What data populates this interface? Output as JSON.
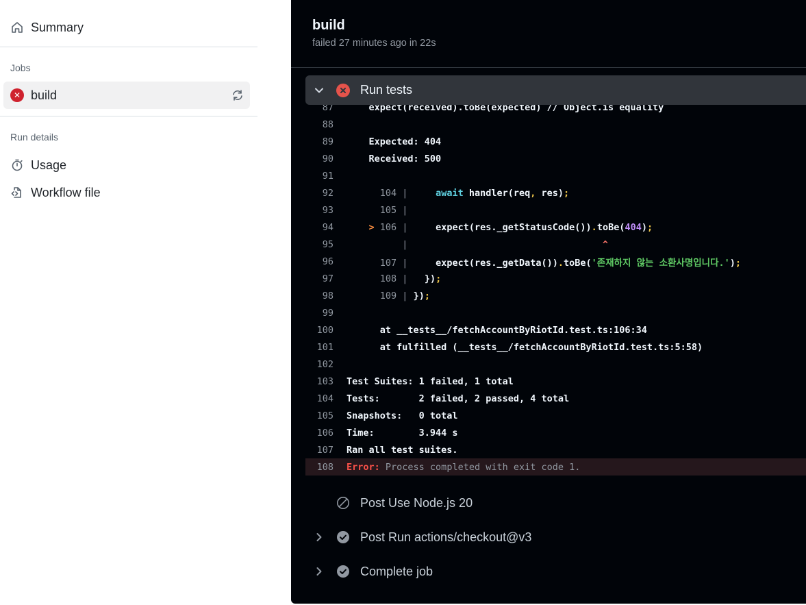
{
  "sidebar": {
    "summary_label": "Summary",
    "jobs_heading": "Jobs",
    "jobs": [
      {
        "label": "build",
        "status": "failed"
      }
    ],
    "run_details_heading": "Run details",
    "usage_label": "Usage",
    "workflow_file_label": "Workflow file"
  },
  "job": {
    "title": "build",
    "meta": "failed 27 minutes ago in 22s"
  },
  "step": {
    "title": "Run tests",
    "status": "failed"
  },
  "log_lines": [
    {
      "n": "87",
      "text": "    expect(received).toBe(expected) // Object.is equality"
    },
    {
      "n": "88",
      "text": ""
    },
    {
      "n": "89",
      "text": "    Expected: 404"
    },
    {
      "n": "90",
      "text": "    Received: 500"
    },
    {
      "n": "91",
      "text": ""
    },
    {
      "n": "92",
      "text": "      104 |     await handler(req, res);"
    },
    {
      "n": "93",
      "text": "      105 |"
    },
    {
      "n": "94",
      "text": "    > 106 |     expect(res._getStatusCode()).toBe(404);"
    },
    {
      "n": "95",
      "text": "          |                                   ^"
    },
    {
      "n": "96",
      "text": "      107 |     expect(res._getData()).toBe('존재하지 않는 소환사명입니다.');"
    },
    {
      "n": "97",
      "text": "      108 |   });"
    },
    {
      "n": "98",
      "text": "      109 | });"
    },
    {
      "n": "99",
      "text": ""
    },
    {
      "n": "100",
      "text": "      at __tests__/fetchAccountByRiotId.test.ts:106:34"
    },
    {
      "n": "101",
      "text": "      at fulfilled (__tests__/fetchAccountByRiotId.test.ts:5:58)"
    },
    {
      "n": "102",
      "text": ""
    },
    {
      "n": "103",
      "text": "Test Suites: 1 failed, 1 total"
    },
    {
      "n": "104",
      "text": "Tests:       2 failed, 2 passed, 4 total"
    },
    {
      "n": "105",
      "text": "Snapshots:   0 total"
    },
    {
      "n": "106",
      "text": "Time:        3.944 s"
    },
    {
      "n": "107",
      "text": "Ran all test suites."
    },
    {
      "n": "108",
      "error_label": "Error:",
      "text": " Process completed with exit code 1."
    }
  ],
  "steps_after": [
    {
      "label": "Post Use Node.js 20",
      "status": "skipped",
      "expandable": false
    },
    {
      "label": "Post Run actions/checkout@v3",
      "status": "success",
      "expandable": true
    },
    {
      "label": "Complete job",
      "status": "success",
      "expandable": true
    }
  ],
  "colors": {
    "panel_bg": "#010409",
    "step_header_bg": "#31353b",
    "error_red": "#f85149",
    "failed_badge": "#cf222e"
  }
}
